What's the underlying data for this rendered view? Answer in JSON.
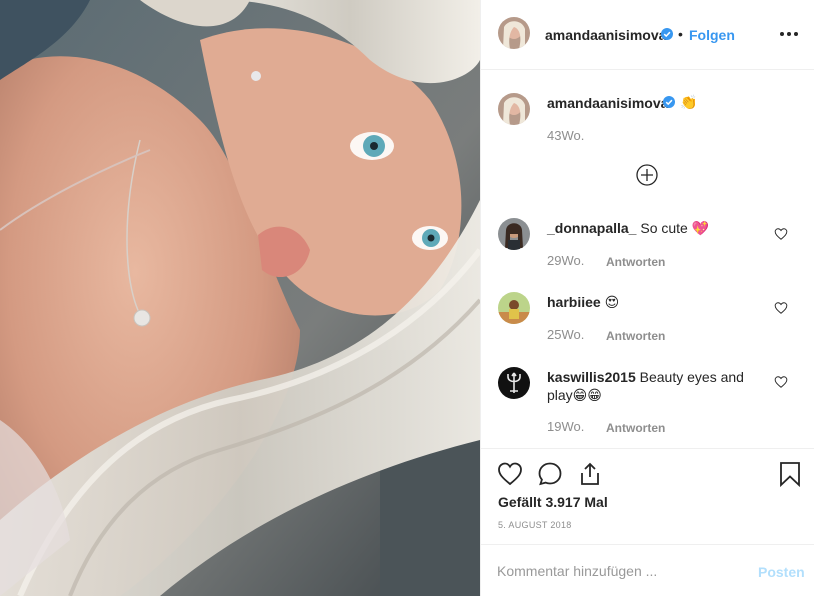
{
  "post": {
    "photo_icon": "selfie-photo",
    "author": {
      "username": "amandaanisimova",
      "verified": true,
      "dot": "•",
      "follow_label": "Folgen"
    },
    "caption": {
      "username": "amandaanisimova",
      "emoji": "👏",
      "time": "43Wo."
    },
    "load_more_icon": "plus-circle-icon",
    "comments": [
      {
        "username": "_donnapalla_",
        "text": "So cute 💖",
        "time": "29Wo.",
        "reply_label": "Antworten"
      },
      {
        "username": "harbiiee",
        "text": "😍",
        "time": "25Wo.",
        "reply_label": "Antworten"
      },
      {
        "username": "kaswillis2015",
        "text": "Beauty eyes and play😁😁",
        "time": "19Wo.",
        "reply_label": "Antworten"
      }
    ],
    "likes_label": "Gefällt 3.917 Mal",
    "date": "5. AUGUST 2018",
    "comment_placeholder": "Kommentar hinzufügen ...",
    "post_button": "Posten"
  },
  "colors": {
    "accent": "#3897f0",
    "post_disabled": "#b2dffc",
    "muted": "#8e8e8e",
    "text": "#262626",
    "border": "#efefef"
  }
}
